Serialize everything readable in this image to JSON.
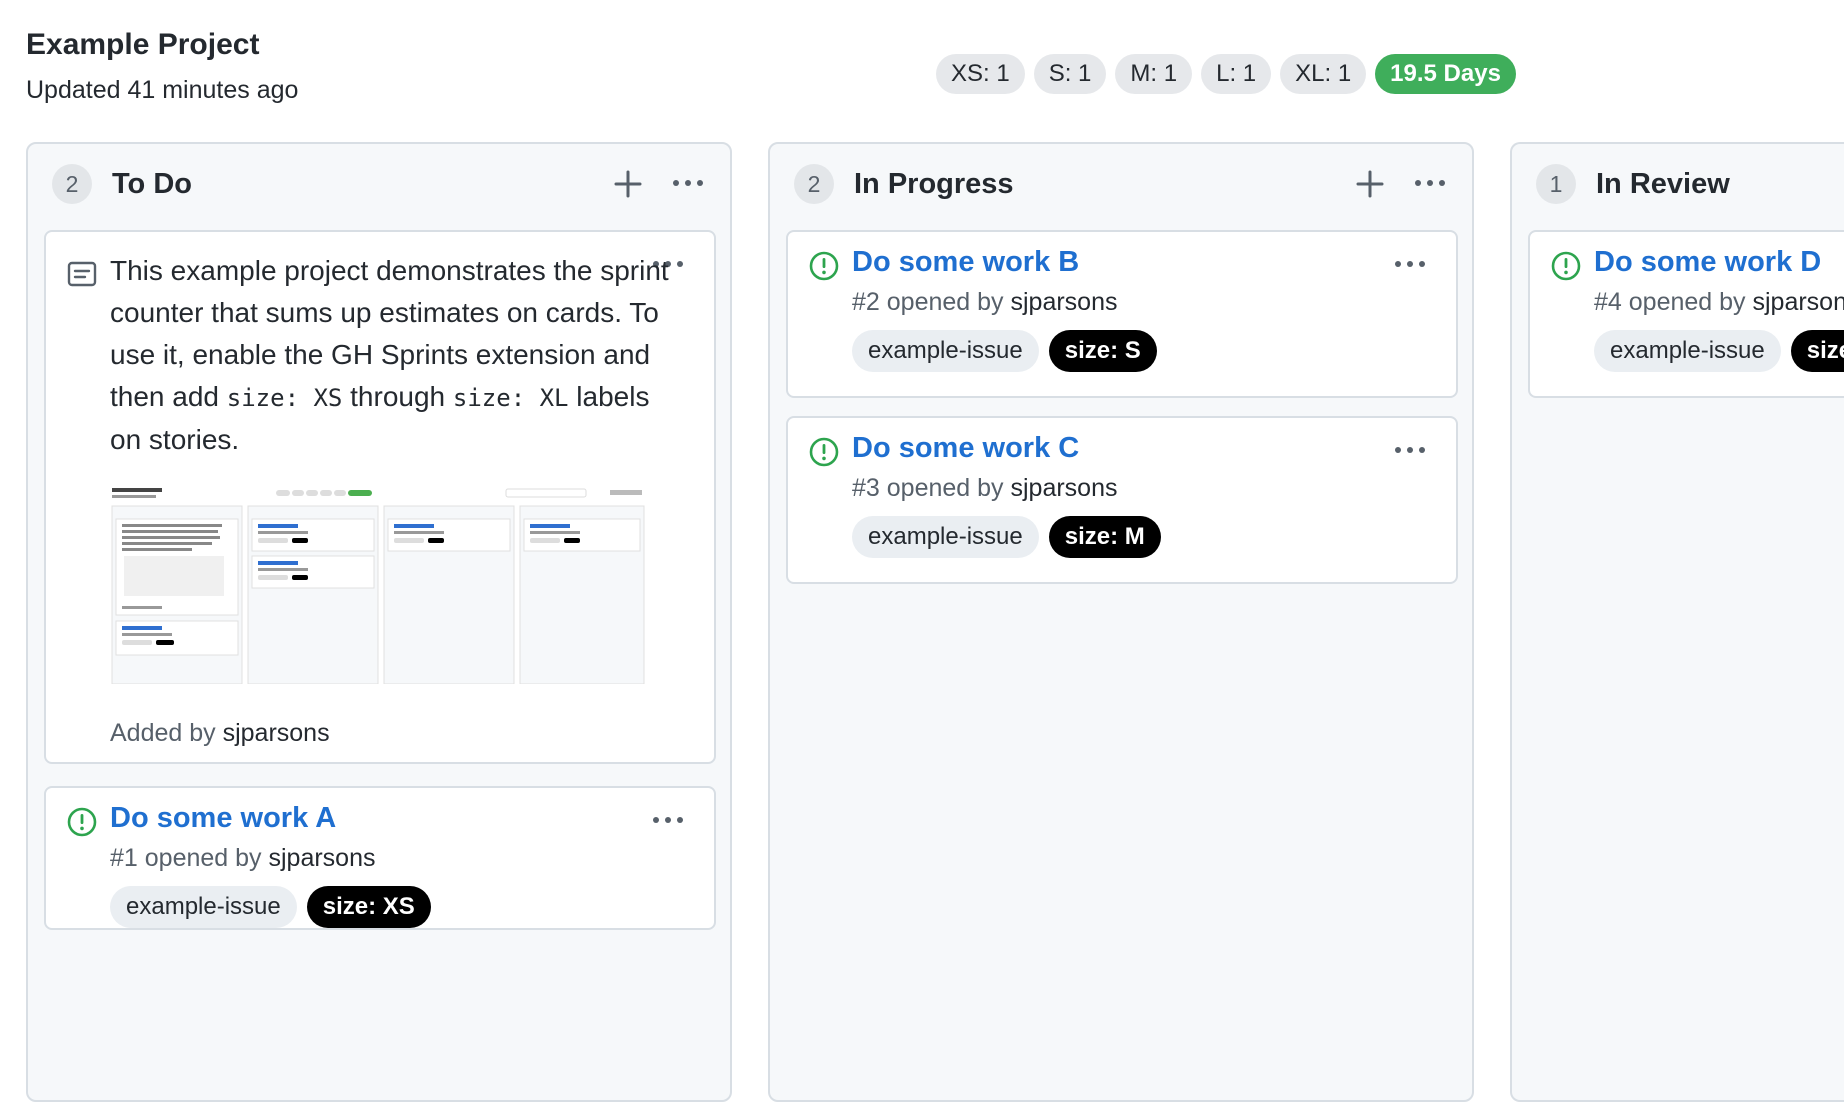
{
  "project": {
    "title": "Example Project",
    "updated": "Updated 41 minutes ago"
  },
  "sprint_counter": {
    "sizes": [
      {
        "label": "XS: 1"
      },
      {
        "label": "S: 1"
      },
      {
        "label": "M: 1"
      },
      {
        "label": "L: 1"
      },
      {
        "label": "XL: 1"
      }
    ],
    "total": "19.5 Days",
    "total_color": "#3fae5b"
  },
  "icons": {
    "add": "plus-icon",
    "more": "kebab-horizontal-icon",
    "issue": "issue-opened-icon",
    "note": "note-icon"
  },
  "colors": {
    "link": "#1f6fd0",
    "issue_open": "#2da44e",
    "size_label_bg": "#000000"
  },
  "columns": [
    {
      "name": "To Do",
      "count": "2",
      "note": {
        "text_1": "This example project demonstrates the sprint counter that sums up estimates on cards. To use it, enable the GH Sprints extension and then add",
        "code_1": "size: XS",
        "text_2": "through",
        "code_2": "size: XL",
        "text_3": "labels on stories.",
        "added_prefix": "Added by",
        "added_by": "sjparsons"
      },
      "cards": [
        {
          "title": "Do some work A",
          "number": "#1",
          "opened_by_prefix": "opened by",
          "author": "sjparsons",
          "labels": [
            "example-issue",
            "size: XS"
          ]
        }
      ]
    },
    {
      "name": "In Progress",
      "count": "2",
      "cards": [
        {
          "title": "Do some work B",
          "number": "#2",
          "opened_by_prefix": "opened by",
          "author": "sjparsons",
          "labels": [
            "example-issue",
            "size: S"
          ]
        },
        {
          "title": "Do some work C",
          "number": "#3",
          "opened_by_prefix": "opened by",
          "author": "sjparsons",
          "labels": [
            "example-issue",
            "size: M"
          ]
        }
      ]
    },
    {
      "name": "In Review",
      "count": "1",
      "cards": [
        {
          "title": "Do some work D",
          "number": "#4",
          "opened_by_prefix": "opened by",
          "author": "sjparsons",
          "labels": [
            "example-issue",
            "size: L"
          ]
        }
      ]
    }
  ]
}
